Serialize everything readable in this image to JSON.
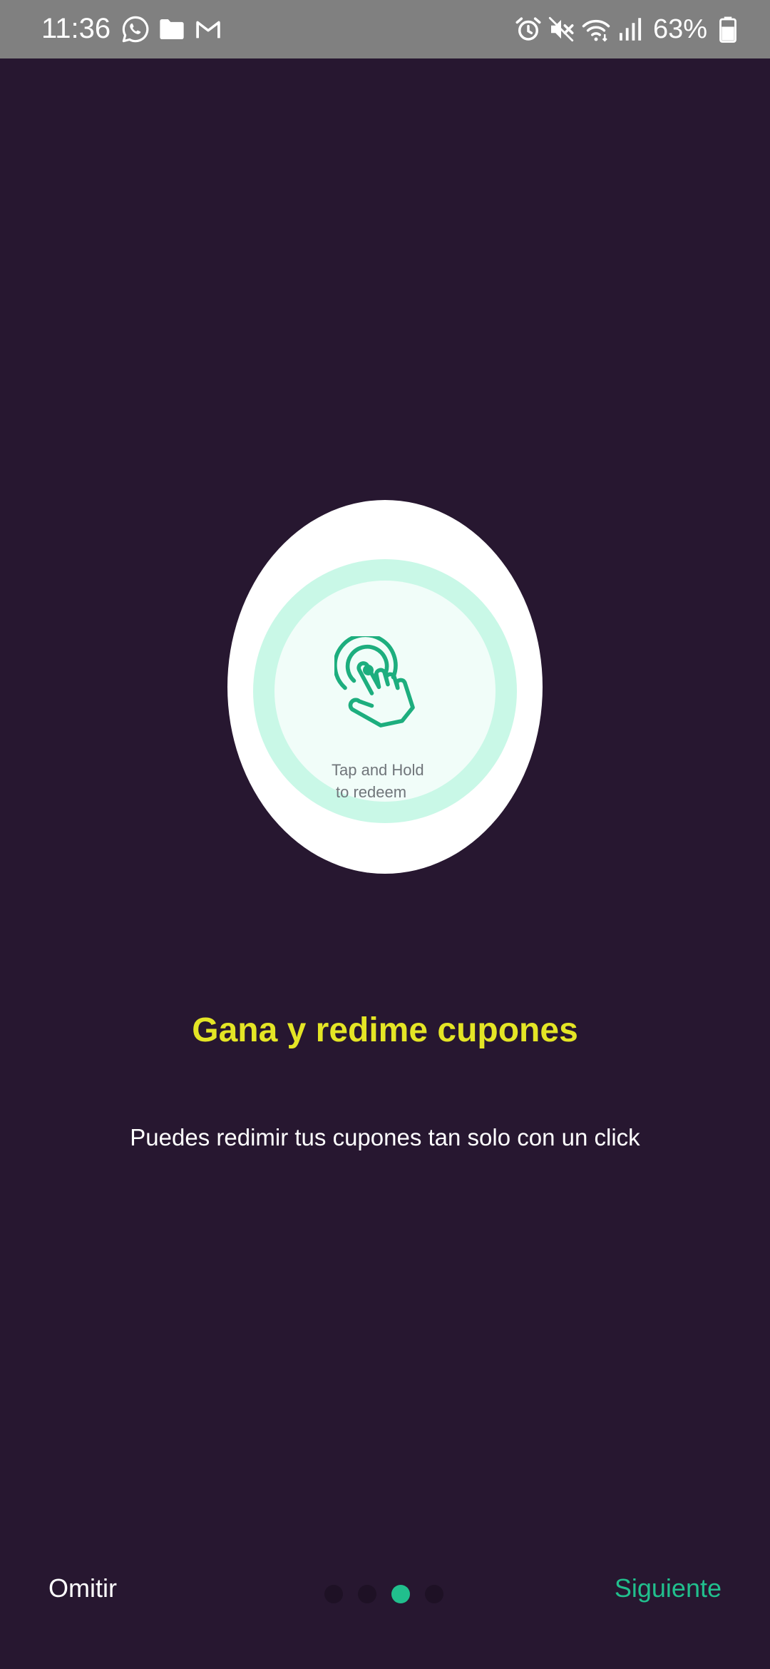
{
  "status_bar": {
    "time": "11:36",
    "battery": "63%",
    "notification_icons": [
      "whatsapp-icon",
      "folder-icon",
      "gmail-icon"
    ],
    "system_icons": [
      "alarm-icon",
      "mute-icon",
      "wifi-icon",
      "signal-icon",
      "battery-icon"
    ]
  },
  "illustration": {
    "caption_line1": "Tap and Hold",
    "caption_line2": "to redeem",
    "icon": "tap-hand-icon"
  },
  "content": {
    "title": "Gana y redime cupones",
    "subtitle": "Puedes redimir tus cupones tan solo con un click"
  },
  "navigation": {
    "skip_label": "Omitir",
    "next_label": "Siguiente",
    "page_count": 4,
    "current_page": 3
  },
  "colors": {
    "background": "#271730",
    "title": "#e4e525",
    "accent": "#21bf8d",
    "status_bar": "#808080"
  }
}
